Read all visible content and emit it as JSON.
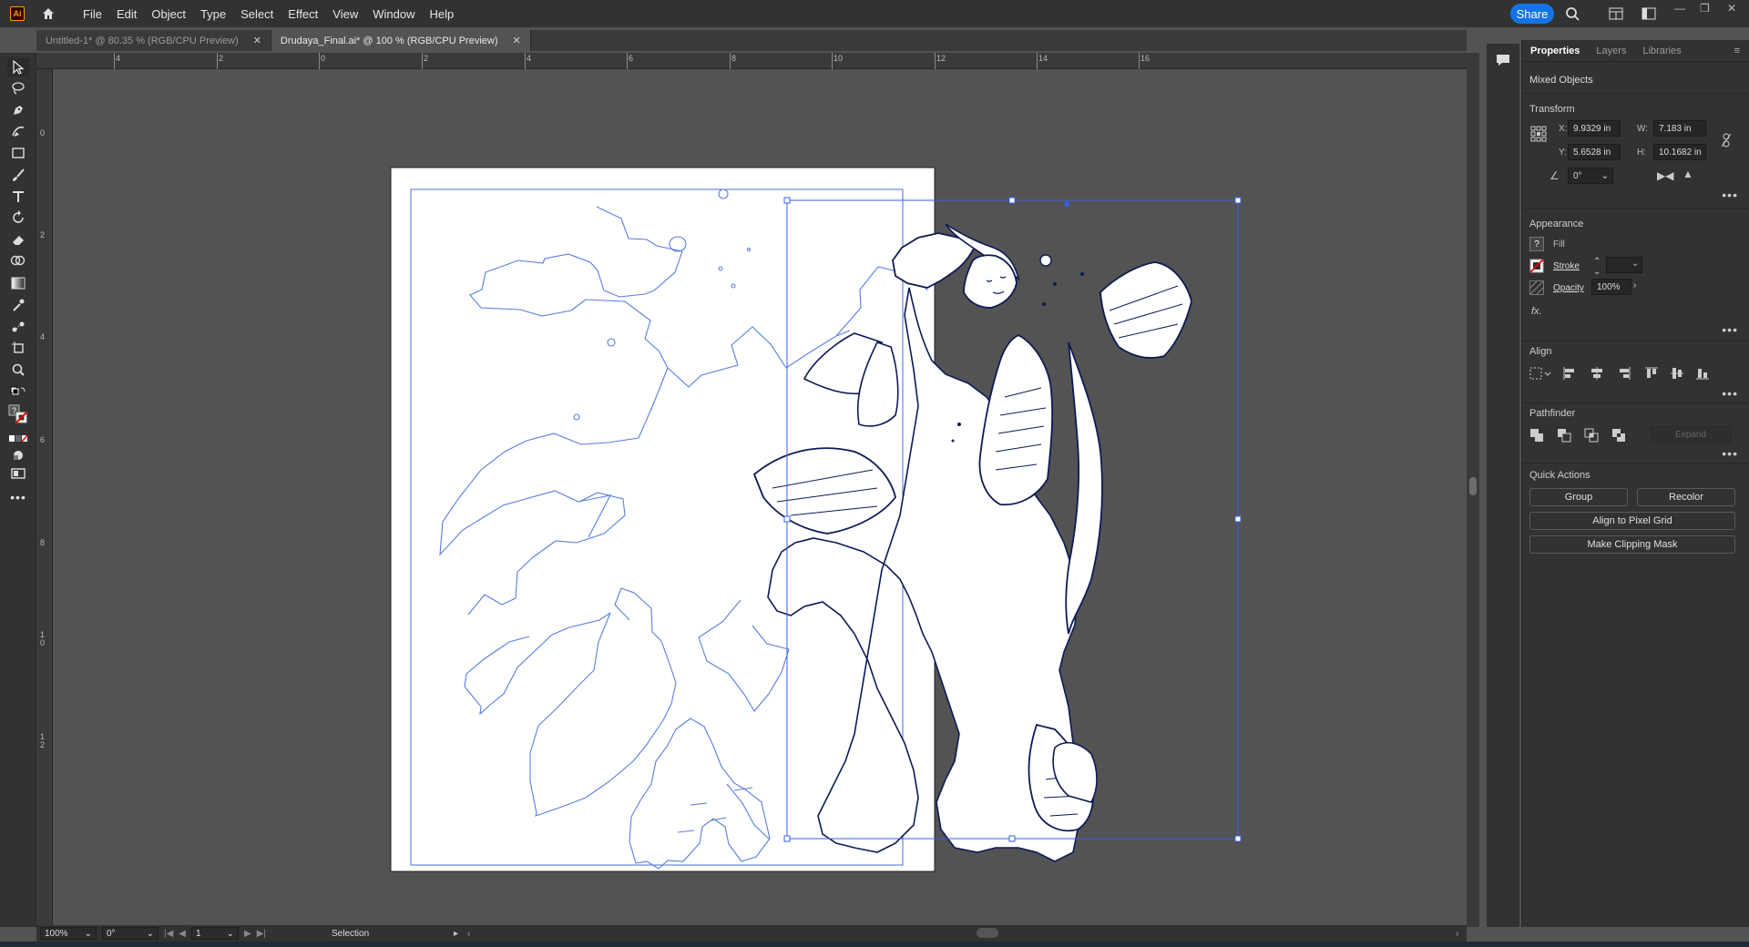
{
  "app": {
    "logo": "Ai",
    "accent": "#1473e6",
    "logo_color": "#ff9a00"
  },
  "menu": [
    "File",
    "Edit",
    "Object",
    "Type",
    "Select",
    "Effect",
    "View",
    "Window",
    "Help"
  ],
  "share_label": "Share",
  "tabs": [
    {
      "label": "Untitled-1* @ 80.35 % (RGB/CPU Preview)"
    },
    {
      "label": "Drudaya_Final.ai* @ 100 % (RGB/CPU Preview)"
    }
  ],
  "ruler_top_labels": [
    "4",
    "2",
    "0",
    "2",
    "4",
    "6",
    "8",
    "10",
    "12",
    "14",
    "16"
  ],
  "ruler_left_labels": [
    "0",
    "2",
    "4",
    "6",
    "8",
    "1\n0",
    "1\n2"
  ],
  "status": {
    "zoom": "100%",
    "rotation": "0°",
    "artboard": "1",
    "tool": "Selection"
  },
  "panel": {
    "tabs": [
      "Properties",
      "Layers",
      "Libraries"
    ],
    "object_type": "Mixed Objects",
    "transform": {
      "title": "Transform",
      "x_label": "X:",
      "x": "9.9329 in",
      "y_label": "Y:",
      "y": "5.6528 in",
      "w_label": "W:",
      "w": "7.183 in",
      "h_label": "H:",
      "h": "10.1682 in",
      "angle": "0°"
    },
    "appearance": {
      "title": "Appearance",
      "fill": "Fill",
      "stroke": "Stroke",
      "opacity_label": "Opacity",
      "opacity": "100%",
      "fx": "fx."
    },
    "align": {
      "title": "Align"
    },
    "pathfinder": {
      "title": "Pathfinder",
      "expand": "Expand"
    },
    "quick_actions": {
      "title": "Quick Actions",
      "group": "Group",
      "recolor": "Recolor",
      "pixel_grid": "Align to Pixel Grid",
      "clipping": "Make Clipping Mask"
    }
  }
}
